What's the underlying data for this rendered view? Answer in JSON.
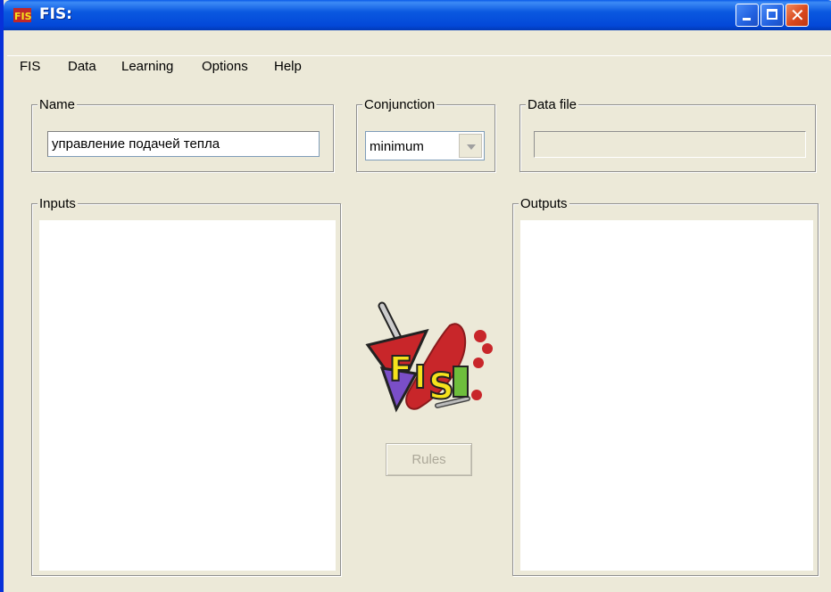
{
  "window": {
    "title": "FIS:",
    "app_icon": "fis-logo-icon",
    "controls": [
      "minimize-icon",
      "maximize-icon",
      "close-icon"
    ]
  },
  "menu": {
    "items": [
      {
        "label": "FIS"
      },
      {
        "label": "Data"
      },
      {
        "label": "Learning"
      },
      {
        "label": "Options"
      },
      {
        "label": "Help"
      }
    ]
  },
  "name_group": {
    "label": "Name",
    "value": "управление подачей тепла"
  },
  "conjunction_group": {
    "label": "Conjunction",
    "selected": "minimum"
  },
  "data_file_group": {
    "label": "Data file",
    "value": ""
  },
  "inputs_group": {
    "label": "Inputs",
    "items": []
  },
  "outputs_group": {
    "label": "Outputs",
    "items": []
  },
  "logo": {
    "icon": "fis-logo-icon"
  },
  "rules_button": {
    "label": "Rules",
    "enabled": false
  },
  "colors": {
    "titlebar": "#0a58e0",
    "background": "#ece9d8",
    "close_button": "#d9481e"
  }
}
